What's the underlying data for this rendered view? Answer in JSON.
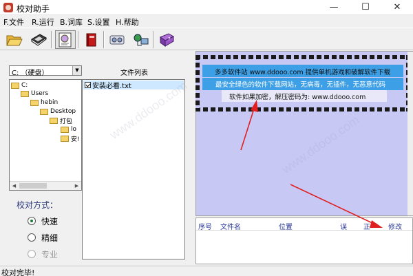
{
  "window": {
    "title": "校对助手",
    "controls": {
      "minimize": "—",
      "maximize": "☐",
      "close": "✕"
    }
  },
  "menu": [
    {
      "label": "F.文件"
    },
    {
      "label": "R.运行"
    },
    {
      "label": "B.词库"
    },
    {
      "label": "S.设置"
    },
    {
      "label": "H.帮助"
    }
  ],
  "toolbar": {
    "buttons": [
      {
        "icon": "folder-open-icon"
      },
      {
        "icon": "floppy-save-icon"
      },
      {
        "icon": "document-stamp-icon"
      },
      {
        "icon": "red-book-icon"
      },
      {
        "icon": "speaker-icon"
      },
      {
        "icon": "network-icon"
      },
      {
        "icon": "help-book-icon"
      }
    ]
  },
  "left": {
    "drive": "C: （硬盘）",
    "file_list_title": "文件列表",
    "tree": [
      {
        "label": "C:"
      },
      {
        "label": "Users"
      },
      {
        "label": "hebin"
      },
      {
        "label": "Desktop"
      },
      {
        "label": "打包"
      },
      {
        "label": "lo"
      },
      {
        "label": "安!"
      }
    ],
    "files": [
      {
        "name": "安装必看.txt",
        "checked": true
      }
    ],
    "method_label": "校对方式：",
    "methods": [
      {
        "label": "快速",
        "selected": true,
        "disabled": false
      },
      {
        "label": "精细",
        "selected": false,
        "disabled": false
      },
      {
        "label": "专业",
        "selected": false,
        "disabled": true
      }
    ]
  },
  "preview": {
    "line1": "多多软件站 www.ddooo.com 提供单机游戏和破解软件下载",
    "line2": "最安全绿色的软件下载网站，无病毒，无插件，无恶意代码",
    "line3": "软件如果加密，解压密码为: www.ddooo.com"
  },
  "results": {
    "columns": [
      "序号",
      "文件名",
      "位置",
      "误",
      "正",
      "修改"
    ]
  },
  "status": {
    "text": "校对完毕!"
  },
  "watermark": "www.ddooo.com"
}
